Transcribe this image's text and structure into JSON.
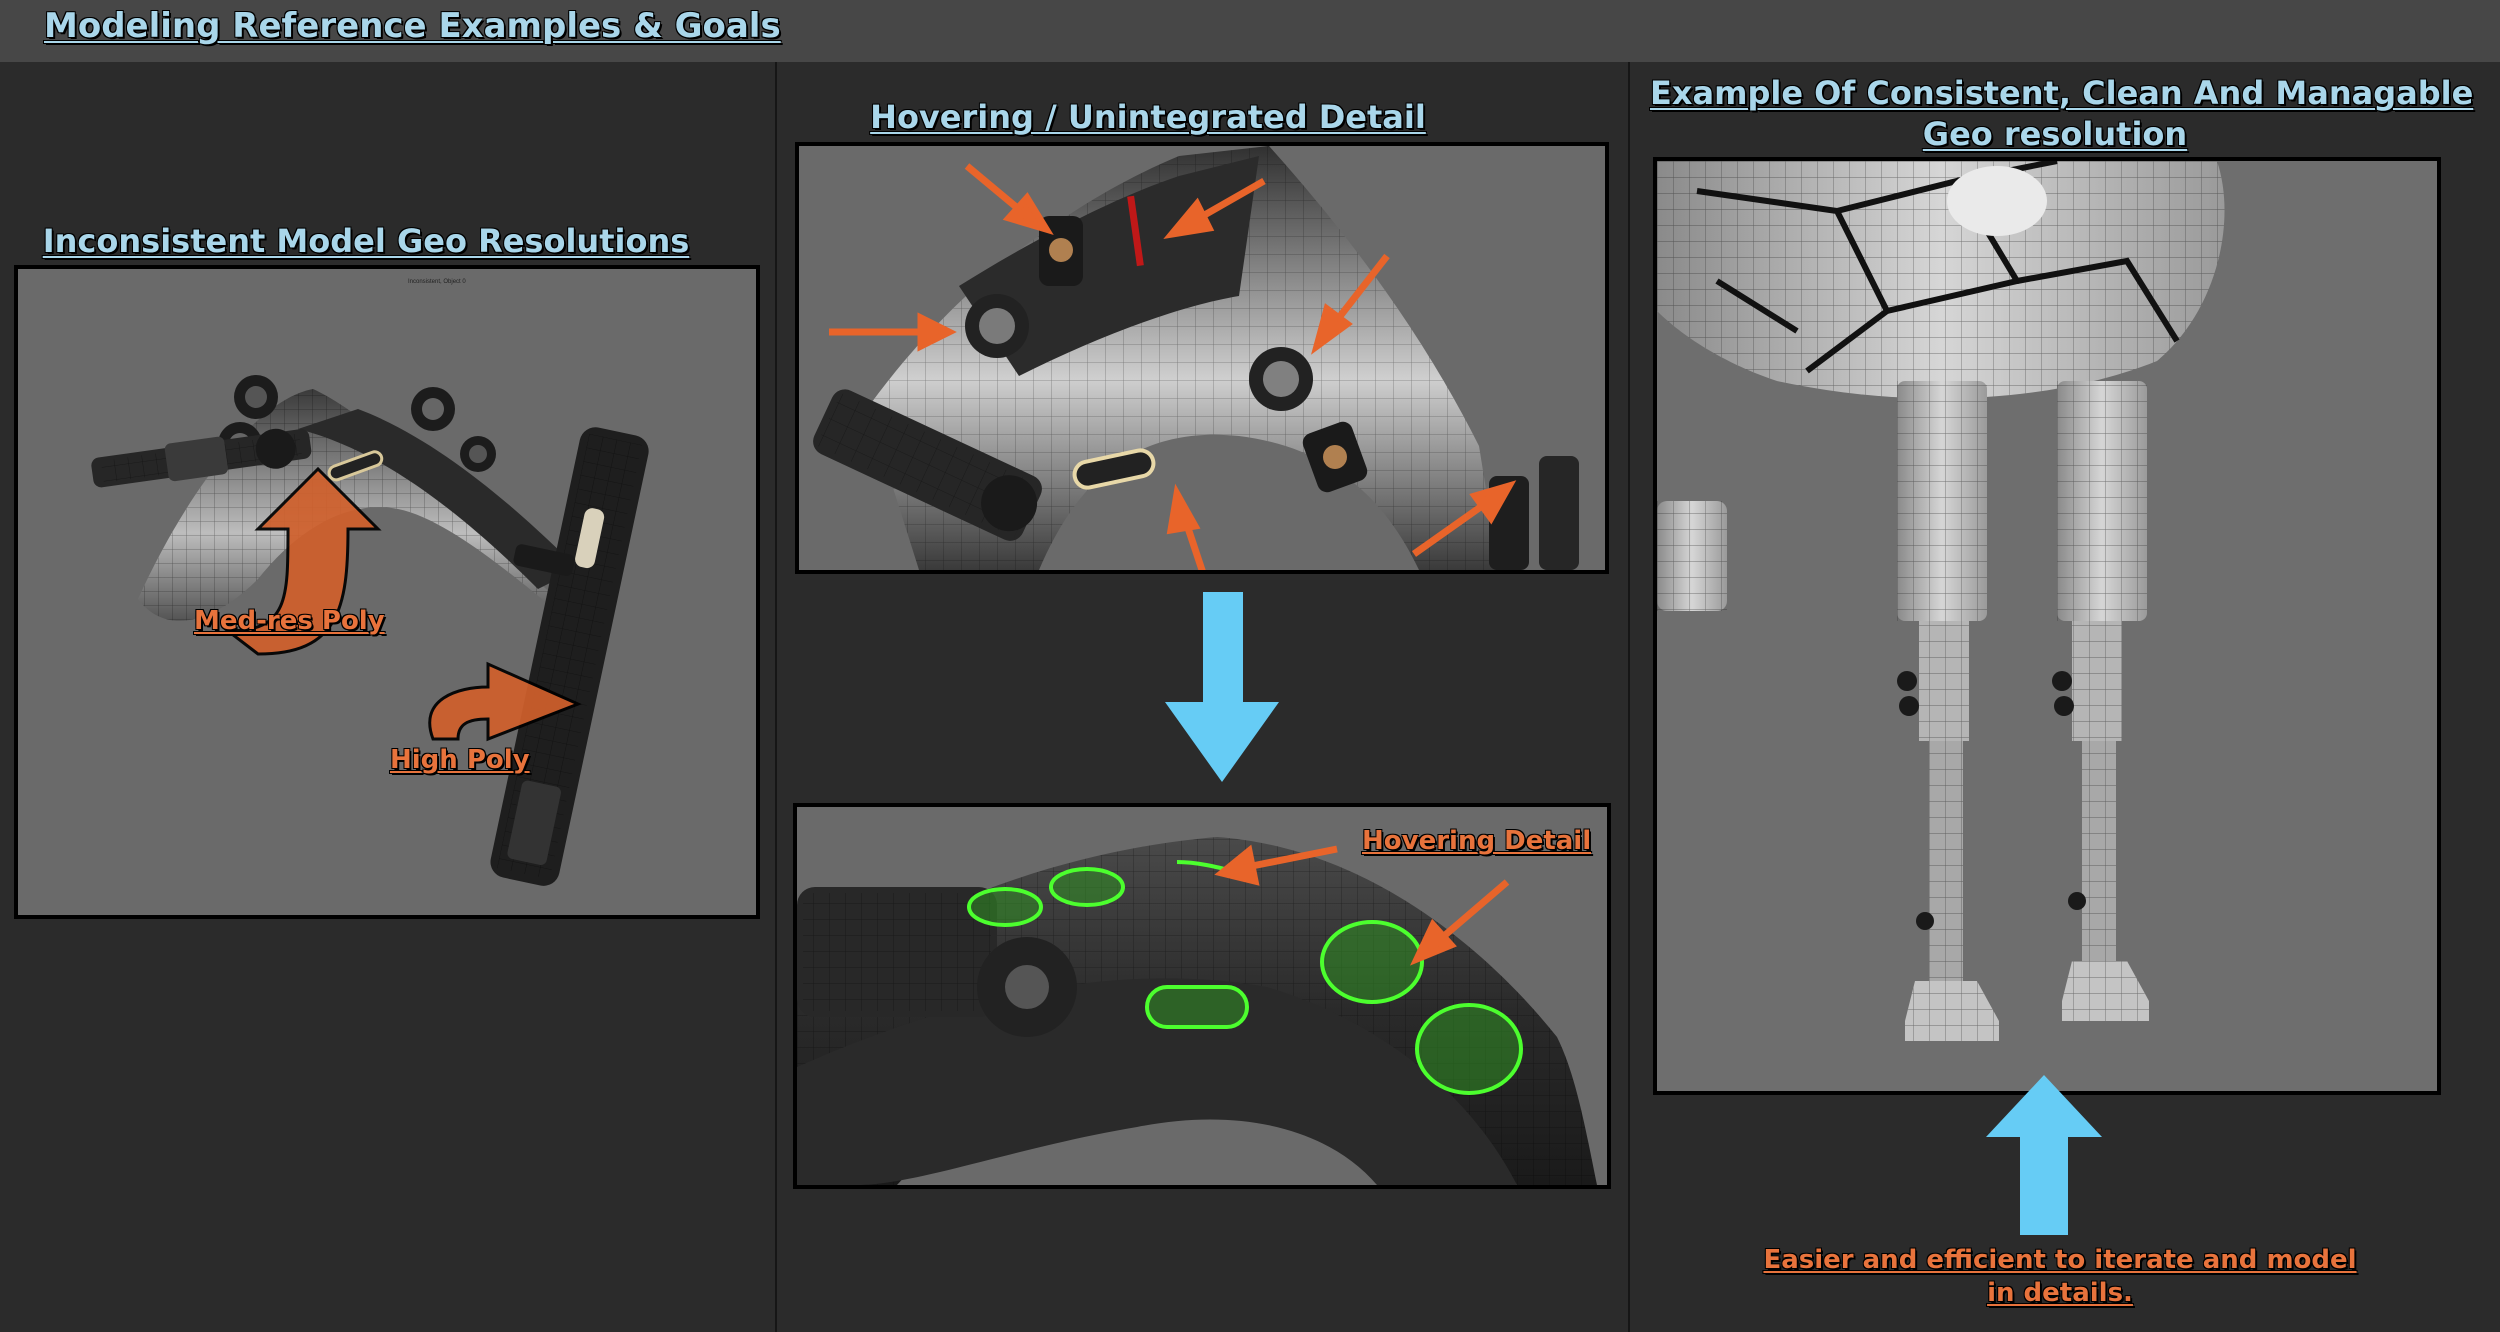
{
  "header": {
    "title": "Modeling Reference Examples & Goals"
  },
  "section_left": {
    "title": "Inconsistent Model Geo Resolutions",
    "tiny_caption": "Inconsistent, Object 0",
    "label_medres": "Med-res Poly",
    "label_highpoly": "High Poly"
  },
  "section_middle": {
    "title": "Hovering / Unintegrated Detail",
    "label_hovering": "Hovering Detail"
  },
  "section_right": {
    "title_line1": "Example Of Consistent, Clean And Managable",
    "title_line2": "Geo resolution",
    "note_line1": "Easier and efficient to iterate and model",
    "note_line2": "in details."
  },
  "colors": {
    "header_bg": "#474747",
    "page_bg": "#2b2b2b",
    "title_blue": "#a9d6ea",
    "callout_orange": "#e8733c",
    "arrow_blue": "#66ccf5",
    "highlight_green": "#4cff2e"
  }
}
